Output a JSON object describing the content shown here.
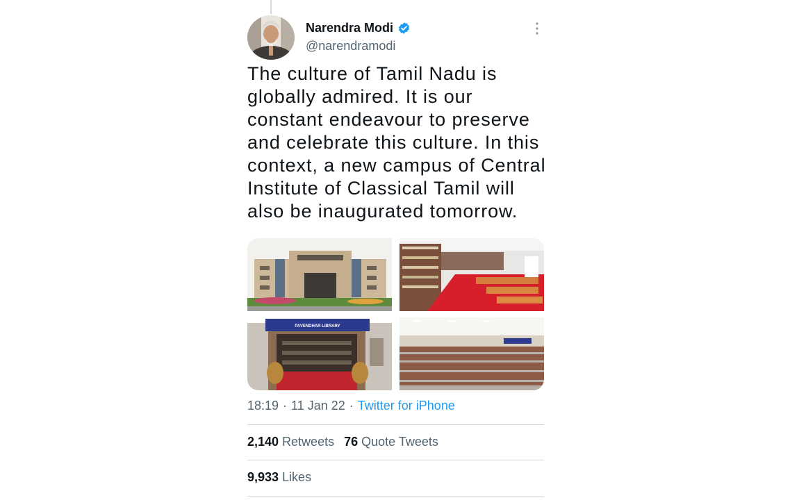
{
  "tweet": {
    "author_name": "Narendra Modi",
    "author_handle": "@narendramodi",
    "text": "The culture of Tamil Nadu is globally admired. It is our constant endeavour to preserve and celebrate this culture. In this context, a new campus of Central Institute of Classical Tamil will also be inaugurated tomorrow.",
    "time": "18:19",
    "date": "11 Jan 22",
    "source": "Twitter for iPhone",
    "meta_separator": "·",
    "media_sign_text": "PAVENDHAR LIBRARY"
  },
  "stats": {
    "retweets_count": "2,140",
    "retweets_label": "Retweets",
    "quotes_count": "76",
    "quotes_label": "Quote Tweets",
    "likes_count": "9,933",
    "likes_label": "Likes"
  },
  "colors": {
    "link": "#1d9bf0",
    "secondary_text": "#536471",
    "divider": "#cfd9de",
    "verified_badge": "#1d9bf0"
  },
  "icons": {
    "verified": "verified-badge-icon",
    "more": "more-options-icon"
  }
}
